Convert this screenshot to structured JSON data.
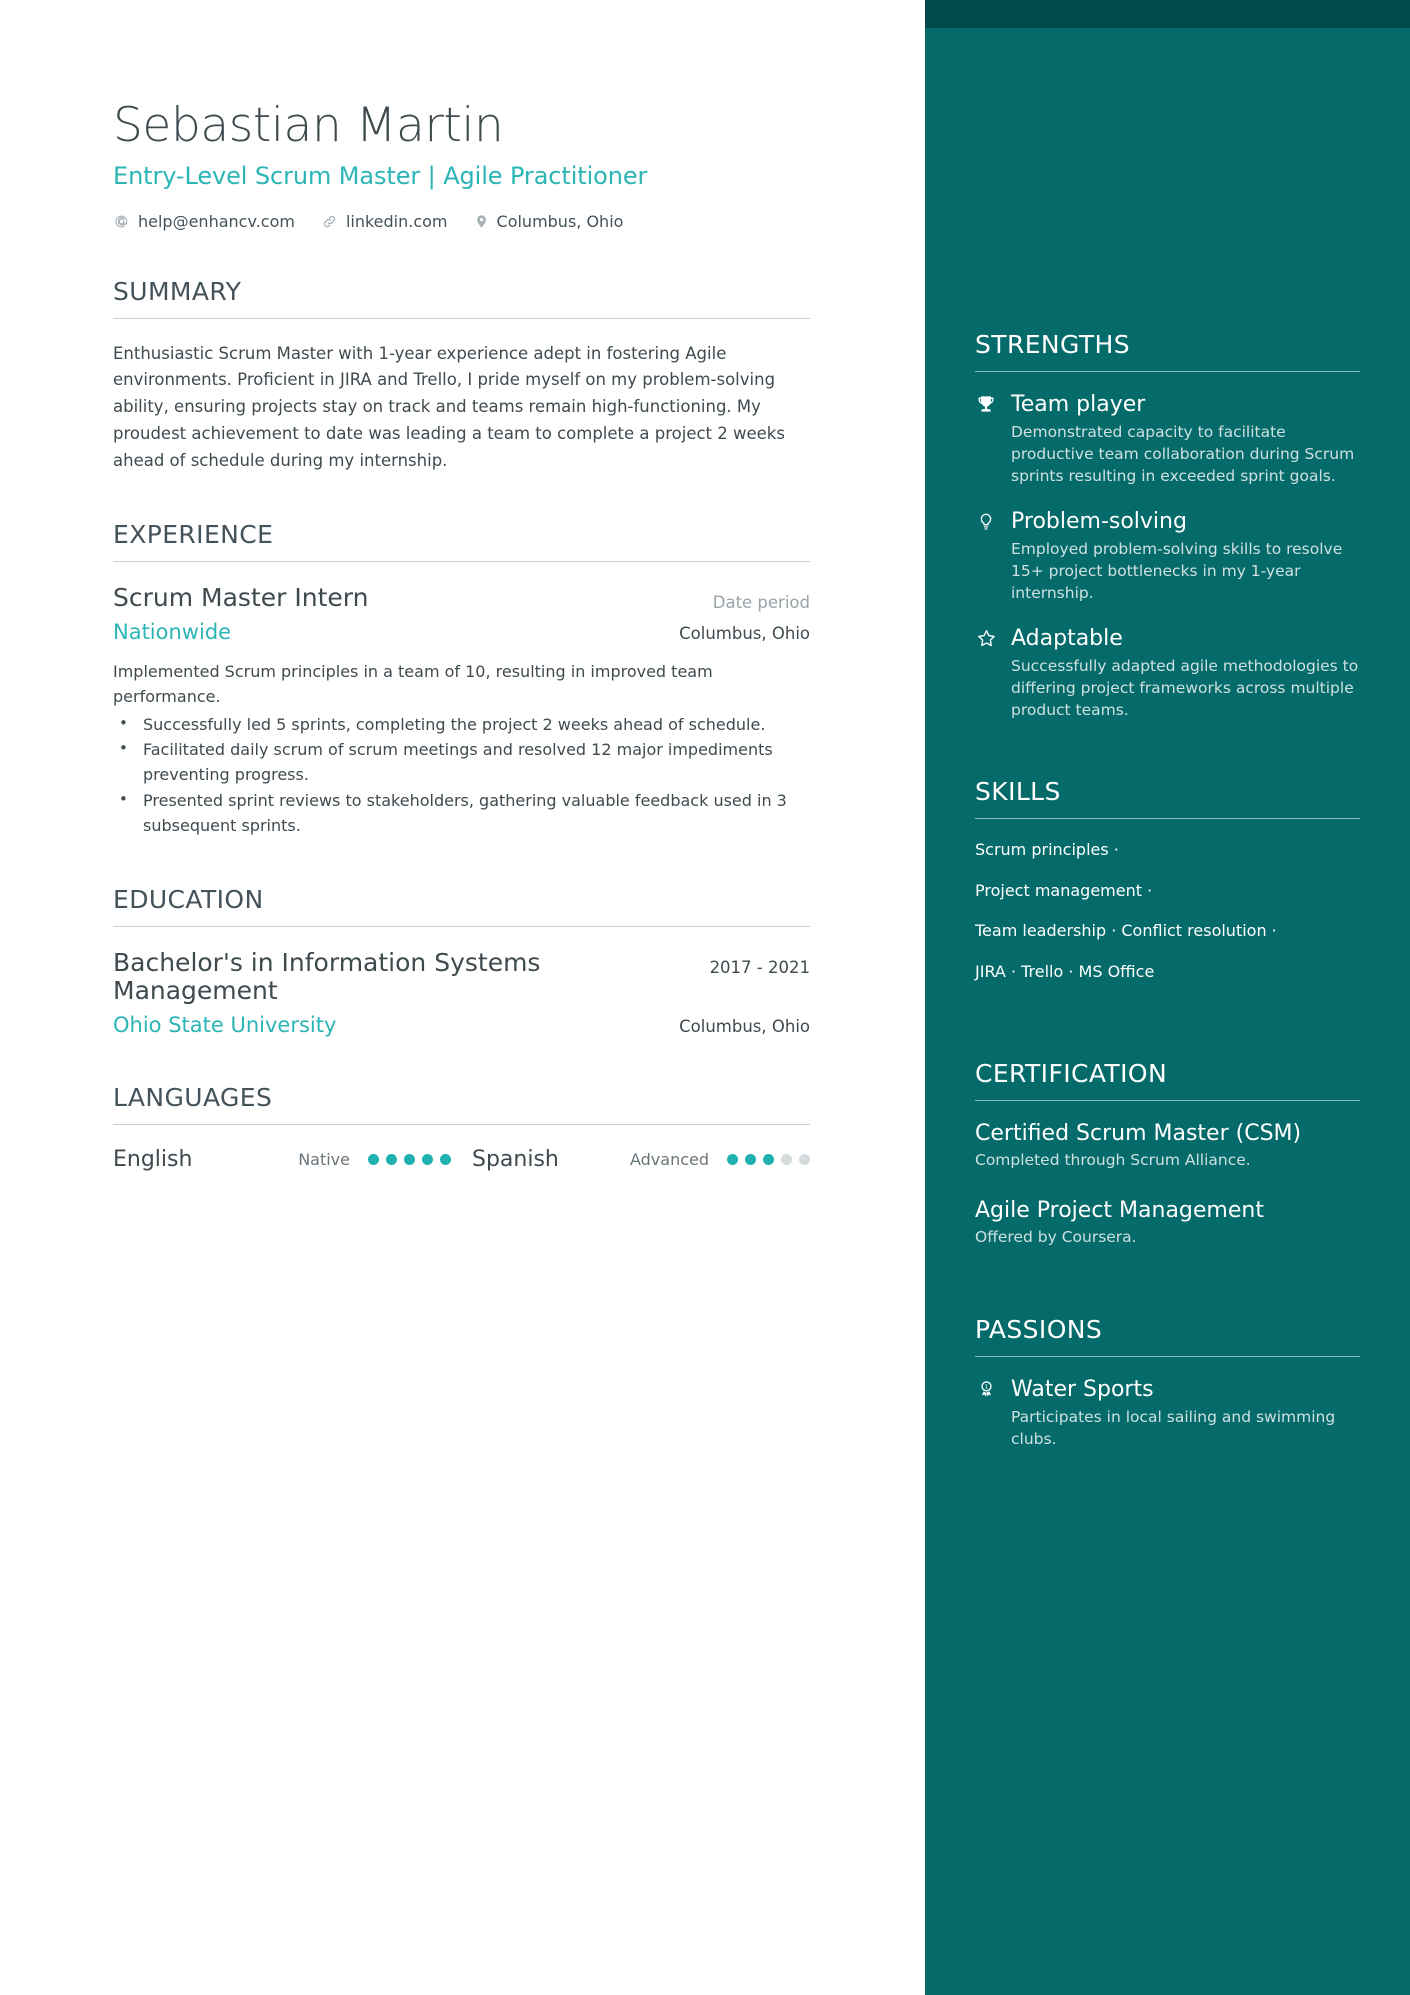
{
  "theme": {
    "sidebar_bg": "#046A6A",
    "sidebar_topbar_bg": "#024A4A",
    "accent": "#2BB5B5",
    "text_dark": "#3F4A4F",
    "text_muted": "#9AA3A8",
    "sidebar_text_muted": "#CFE0E0"
  },
  "header": {
    "name": "Sebastian Martin",
    "headline": "Entry-Level Scrum Master | Agile Practitioner",
    "contacts": [
      {
        "icon": "at-icon",
        "label": "help@enhancv.com"
      },
      {
        "icon": "link-icon",
        "label": "linkedin.com"
      },
      {
        "icon": "location-pin-icon",
        "label": "Columbus, Ohio"
      }
    ]
  },
  "summary": {
    "title": "SUMMARY",
    "text": "Enthusiastic Scrum Master with 1-year experience adept in fostering Agile environments. Proficient in JIRA and Trello, I pride myself on my problem-solving ability, ensuring projects stay on track and teams remain high-functioning. My proudest achievement to date was leading a team to complete a project 2 weeks ahead of schedule during my internship."
  },
  "experience": {
    "title": "EXPERIENCE",
    "entries": [
      {
        "role": "Scrum Master Intern",
        "date": "Date period",
        "company": "Nationwide",
        "location": "Columbus, Ohio",
        "description": "Implemented Scrum principles in a team of 10, resulting in improved team performance.",
        "bullets": [
          "Successfully led 5 sprints, completing the project 2 weeks ahead of schedule.",
          "Facilitated daily scrum of scrum meetings and resolved 12 major impediments preventing progress.",
          "Presented sprint reviews to stakeholders, gathering valuable feedback used in 3 subsequent sprints."
        ]
      }
    ]
  },
  "education": {
    "title": "EDUCATION",
    "entries": [
      {
        "degree": "Bachelor's in Information Systems Management",
        "date": "2017 - 2021",
        "school": "Ohio State University",
        "location": "Columbus, Ohio"
      }
    ]
  },
  "languages": {
    "title": "LANGUAGES",
    "items": [
      {
        "name": "English",
        "level": "Native",
        "filled": 5,
        "total": 5
      },
      {
        "name": "Spanish",
        "level": "Advanced",
        "filled": 3,
        "total": 5
      }
    ]
  },
  "strengths": {
    "title": "STRENGTHS",
    "items": [
      {
        "icon": "trophy-icon",
        "title": "Team player",
        "description": "Demonstrated capacity to facilitate productive team collaboration during Scrum sprints resulting in exceeded sprint goals."
      },
      {
        "icon": "lightbulb-icon",
        "title": "Problem-solving",
        "description": "Employed problem-solving skills to resolve 15+ project bottlenecks in my 1-year internship."
      },
      {
        "icon": "star-icon",
        "title": "Adaptable",
        "description": "Successfully adapted agile methodologies to differing project frameworks across multiple product teams."
      }
    ]
  },
  "skills": {
    "title": "SKILLS",
    "lines": [
      "Scrum principles ·",
      "Project management ·",
      "Team leadership · Conflict resolution ·",
      "JIRA · Trello · MS Office"
    ]
  },
  "certification": {
    "title": "CERTIFICATION",
    "items": [
      {
        "name": "Certified Scrum Master (CSM)",
        "issuer": "Completed through Scrum Alliance."
      },
      {
        "name": "Agile Project Management",
        "issuer": "Offered by Coursera."
      }
    ]
  },
  "passions": {
    "title": "PASSIONS",
    "items": [
      {
        "icon": "award-ribbon-icon",
        "title": "Water Sports",
        "description": "Participates in local sailing and swimming clubs."
      }
    ]
  }
}
